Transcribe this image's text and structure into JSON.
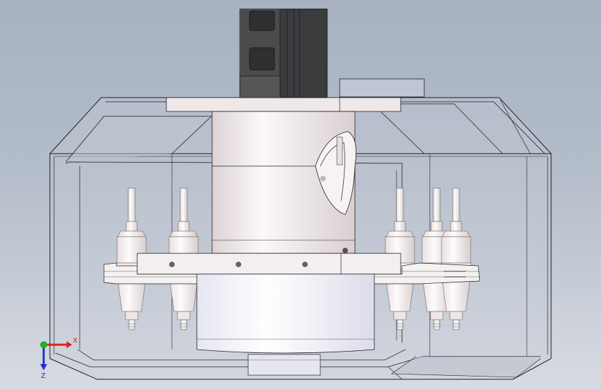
{
  "scene": {
    "background_top": "#a7b1c0",
    "background_bottom": "#d8dbe2",
    "enclosure_fill": "#c7ccd6",
    "motor_color": "#3b3c3e",
    "spindle_color": "#f1ebea",
    "edge_color": "#1c1c22"
  },
  "triad": {
    "x_label": "X",
    "z_label": "Z",
    "x_color": "#e0201c",
    "y_color": "#1fb02a",
    "z_color": "#2030d0"
  }
}
